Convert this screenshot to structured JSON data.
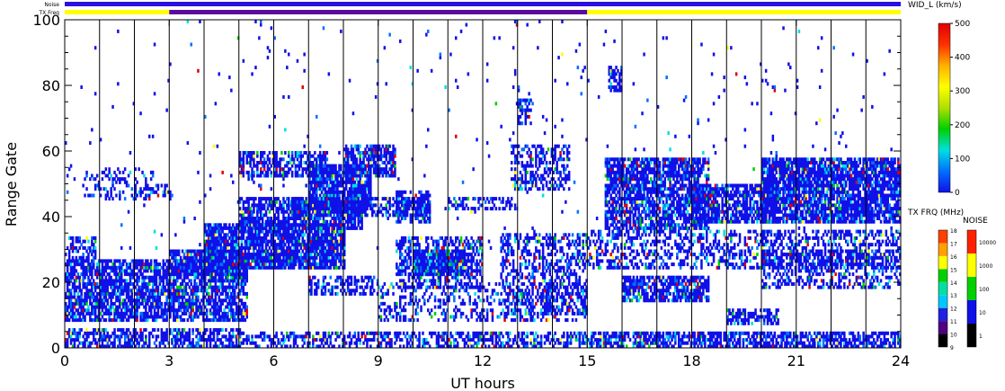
{
  "chart_data": {
    "type": "heatmap",
    "xlabel": "UT hours",
    "ylabel": "Range Gate",
    "xlim": [
      0,
      24
    ],
    "ylim": [
      0,
      100
    ],
    "x_ticks": [
      "0",
      "3",
      "6",
      "9",
      "12",
      "15",
      "18",
      "21",
      "24"
    ],
    "y_ticks": [
      "0",
      "20",
      "40",
      "60",
      "80",
      "100"
    ],
    "vertical_lines_every_hours": 1,
    "grid": false,
    "status_bars": {
      "noise_label": "Noise",
      "txfreq_label": "TX Freq",
      "noise_color": "#2a10e0",
      "txfreq_segments": [
        {
          "start": 0,
          "end": 3,
          "color": "#ffff00"
        },
        {
          "start": 3,
          "end": 15,
          "color": "#5a0aa0"
        },
        {
          "start": 15,
          "end": 24,
          "color": "#ffff00"
        }
      ]
    },
    "colorbars": {
      "width": {
        "label": "WID_L (km/s)",
        "ticks": [
          "0",
          "100",
          "200",
          "300",
          "400",
          "500"
        ],
        "range": [
          0,
          500
        ],
        "colors": [
          "#1010e8",
          "#0070ff",
          "#00e0e0",
          "#00d000",
          "#b0e000",
          "#ffff00",
          "#ffb000",
          "#ff3000",
          "#e00000"
        ]
      },
      "txfreq": {
        "label": "TX FRQ (MHz)",
        "ticks": [
          "9",
          "10",
          "11",
          "12",
          "13",
          "14",
          "15",
          "16",
          "17",
          "18"
        ],
        "colors": [
          "#000000",
          "#500080",
          "#2020e0",
          "#00c8ff",
          "#00e0a0",
          "#00d000",
          "#ffff00",
          "#ffa000",
          "#ff4000"
        ]
      },
      "noise": {
        "label": "NOISE",
        "ticks": [
          "1",
          "10",
          "100",
          "1000",
          "10000"
        ],
        "colors": [
          "#000000",
          "#1010e8",
          "#00d000",
          "#ffff00",
          "#ff2000"
        ]
      }
    },
    "series": [
      {
        "values": [
          {
            "x0": 0.0,
            "x1": 5.2,
            "y0": 8,
            "y1": 27,
            "d": 0.75
          },
          {
            "x0": 0.0,
            "x1": 5.0,
            "y0": 0,
            "y1": 6,
            "d": 0.6
          },
          {
            "x0": 5.0,
            "x1": 15.0,
            "y0": 0,
            "y1": 5,
            "d": 0.5
          },
          {
            "x0": 15.0,
            "x1": 24.0,
            "y0": 0,
            "y1": 5,
            "d": 0.65
          },
          {
            "x0": 0.0,
            "x1": 0.9,
            "y0": 27,
            "y1": 34,
            "d": 0.5
          },
          {
            "x0": 0.5,
            "x1": 2.5,
            "y0": 45,
            "y1": 55,
            "d": 0.25
          },
          {
            "x0": 2.0,
            "x1": 3.0,
            "y0": 46,
            "y1": 50,
            "d": 0.5
          },
          {
            "x0": 3.0,
            "x1": 5.0,
            "y0": 22,
            "y1": 30,
            "d": 0.8
          },
          {
            "x0": 4.0,
            "x1": 8.0,
            "y0": 24,
            "y1": 38,
            "d": 0.85
          },
          {
            "x0": 5.0,
            "x1": 8.5,
            "y0": 36,
            "y1": 46,
            "d": 0.7
          },
          {
            "x0": 5.0,
            "x1": 7.5,
            "y0": 52,
            "y1": 60,
            "d": 0.6
          },
          {
            "x0": 7.0,
            "x1": 8.8,
            "y0": 42,
            "y1": 56,
            "d": 0.85
          },
          {
            "x0": 8.0,
            "x1": 9.5,
            "y0": 52,
            "y1": 62,
            "d": 0.75
          },
          {
            "x0": 6.5,
            "x1": 10.5,
            "y0": 40,
            "y1": 46,
            "d": 0.6
          },
          {
            "x0": 9.5,
            "x1": 12.0,
            "y0": 18,
            "y1": 34,
            "d": 0.5
          },
          {
            "x0": 10.0,
            "x1": 11.5,
            "y0": 22,
            "y1": 30,
            "d": 0.85
          },
          {
            "x0": 9.5,
            "x1": 10.5,
            "y0": 38,
            "y1": 48,
            "d": 0.55
          },
          {
            "x0": 7.0,
            "x1": 9.0,
            "y0": 16,
            "y1": 22,
            "d": 0.5
          },
          {
            "x0": 9.0,
            "x1": 15.0,
            "y0": 8,
            "y1": 20,
            "d": 0.3
          },
          {
            "x0": 11.0,
            "x1": 13.0,
            "y0": 42,
            "y1": 46,
            "d": 0.5
          },
          {
            "x0": 12.5,
            "x1": 15.0,
            "y0": 10,
            "y1": 35,
            "d": 0.4
          },
          {
            "x0": 12.8,
            "x1": 14.5,
            "y0": 48,
            "y1": 62,
            "d": 0.45
          },
          {
            "x0": 13.0,
            "x1": 13.4,
            "y0": 68,
            "y1": 76,
            "d": 0.6
          },
          {
            "x0": 15.6,
            "x1": 16.0,
            "y0": 78,
            "y1": 86,
            "d": 0.65
          },
          {
            "x0": 15.5,
            "x1": 18.5,
            "y0": 36,
            "y1": 58,
            "d": 0.75
          },
          {
            "x0": 18.0,
            "x1": 20.5,
            "y0": 38,
            "y1": 50,
            "d": 0.7
          },
          {
            "x0": 20.0,
            "x1": 24.0,
            "y0": 38,
            "y1": 58,
            "d": 0.8
          },
          {
            "x0": 16.0,
            "x1": 18.5,
            "y0": 14,
            "y1": 22,
            "d": 0.75
          },
          {
            "x0": 15.0,
            "x1": 24.0,
            "y0": 24,
            "y1": 36,
            "d": 0.4
          },
          {
            "x0": 19.0,
            "x1": 20.5,
            "y0": 7,
            "y1": 12,
            "d": 0.6
          },
          {
            "x0": 20.0,
            "x1": 24.0,
            "y0": 18,
            "y1": 30,
            "d": 0.45
          },
          {
            "x0": 0.0,
            "x1": 24.0,
            "y0": 30,
            "y1": 100,
            "d": 0.012
          }
        ]
      }
    ]
  }
}
